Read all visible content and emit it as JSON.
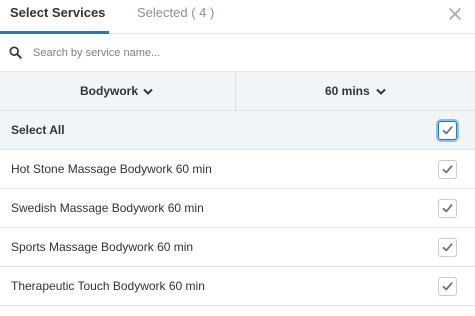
{
  "tabs": {
    "select_services": "Select Services",
    "selected": "Selected ( 4 )"
  },
  "search": {
    "placeholder": "Search by service name..."
  },
  "filters": {
    "category": "Bodywork",
    "duration": "60 mins"
  },
  "select_all": {
    "label": "Select All",
    "checked": true
  },
  "services": [
    {
      "label": "Hot Stone Massage Bodywork 60 min",
      "checked": true
    },
    {
      "label": "Swedish Massage Bodywork 60 min",
      "checked": true
    },
    {
      "label": "Sports Massage Bodywork 60 min",
      "checked": true
    },
    {
      "label": "Therapeutic Touch Bodywork 60 min",
      "checked": true
    }
  ],
  "colors": {
    "accent": "#2b77b5",
    "check": "#6d7378",
    "row_tint": "#f2f5f7"
  }
}
